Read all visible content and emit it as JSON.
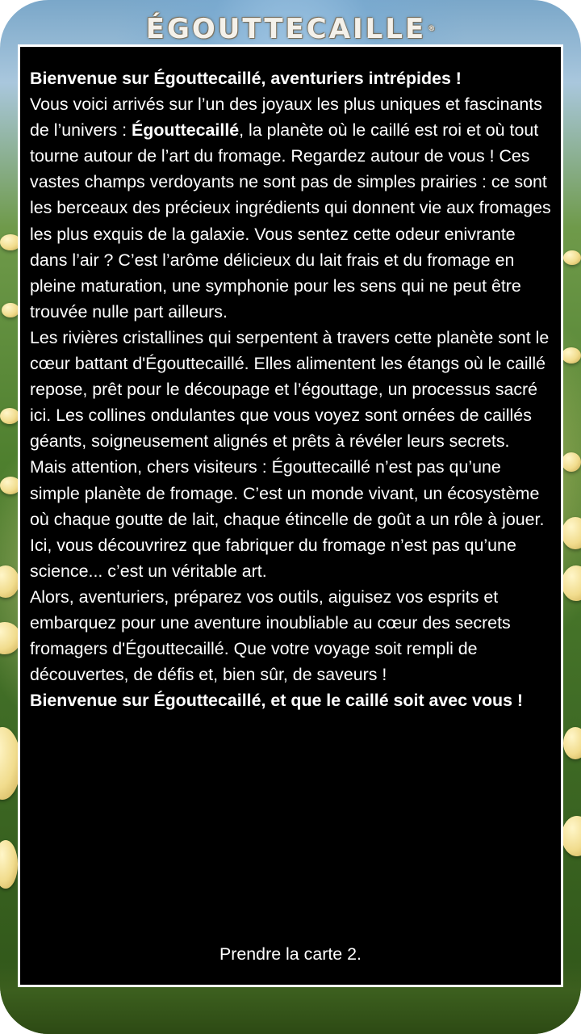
{
  "header": {
    "title": "ÉGOUTTECAILLE",
    "trademark": "®"
  },
  "story": {
    "greeting": "Bienvenue sur Égouttecaillé, aventuriers intrépides !",
    "p1_before": "Vous voici arrivés sur l’un des joyaux les plus uniques et fascinants de l’univers : ",
    "p1_planet": "Égouttecaillé",
    "p1_after": ", la planète où le caillé est roi et où tout tourne autour de l’art du fromage. Regardez autour de vous ! Ces vastes champs verdoyants ne sont pas de simples prairies : ce sont les berceaux des précieux ingrédients qui donnent vie aux fromages les plus exquis de la galaxie. Vous sentez cette odeur enivrante dans l’air ? C’est l’arôme délicieux du lait frais et du fromage en pleine maturation, une symphonie pour les sens qui ne peut être trouvée nulle part ailleurs.",
    "p2": "Les rivières cristallines qui serpentent à travers cette planète sont le cœur battant d'Égouttecaillé. Elles alimentent les étangs où le caillé repose, prêt pour le découpage et l’égouttage, un processus sacré ici. Les collines ondulantes que vous voyez sont ornées de caillés géants, soigneusement alignés et prêts à révéler leurs secrets.",
    "p3": "Mais attention, chers visiteurs : Égouttecaillé n’est pas qu’une simple planète de fromage. C’est un monde vivant, un écosystème où chaque goutte de lait, chaque étincelle de goût a un rôle à jouer. Ici, vous découvrirez que fabriquer du fromage n’est pas qu’une science... c’est un véritable art.",
    "p4": "Alors, aventuriers, préparez vos outils, aiguisez vos esprits et embarquez pour une aventure inoubliable au cœur des secrets fromagers d'Égouttecaillé. Que votre voyage soit rempli de découvertes, de défis et, bien sûr, de saveurs !",
    "closing": "Bienvenue sur Égouttecaillé, et que le caillé soit avec vous !",
    "instruction": "Prendre la carte 2."
  }
}
